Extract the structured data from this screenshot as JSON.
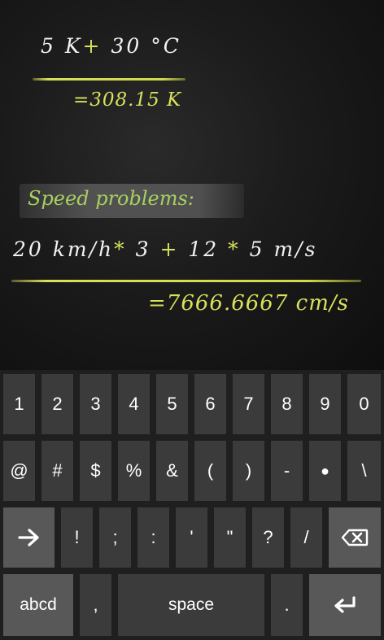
{
  "problem1": {
    "value_a": "5",
    "unit_a": "K",
    "operator": "+",
    "value_b": "30",
    "unit_b": "°C",
    "result": "=308.15 K"
  },
  "problem2": {
    "title": "Speed problems:",
    "value_a": "20",
    "unit_a": "km/h",
    "op1": "*",
    "factor_a": "3",
    "op2": "+",
    "value_b": "12",
    "op3": "*",
    "factor_b": "5",
    "unit_b": "m/s",
    "result": "=7666.6667 cm/s"
  },
  "keyboard": {
    "row1": [
      "1",
      "2",
      "3",
      "4",
      "5",
      "6",
      "7",
      "8",
      "9",
      "0"
    ],
    "row2": [
      "@",
      "#",
      "$",
      "%",
      "&",
      "(",
      ")",
      "-",
      "●",
      "\\"
    ],
    "row3": [
      "!",
      ";",
      ":",
      "'",
      "\"",
      "?",
      "/"
    ],
    "abcd_label": "abcd",
    "comma_label": ",",
    "space_label": "space",
    "period_label": ".",
    "icons": {
      "shift": "arrow-right-icon",
      "backspace": "backspace-icon",
      "enter": "enter-icon"
    },
    "colors": {
      "key": "#3b3b3b",
      "special_key": "#585858",
      "background": "#1f1f1f"
    }
  },
  "colors": {
    "chalk_white": "#f2f2f2",
    "chalk_yellow": "#d9e05c",
    "chalk_green": "#a8d060"
  }
}
